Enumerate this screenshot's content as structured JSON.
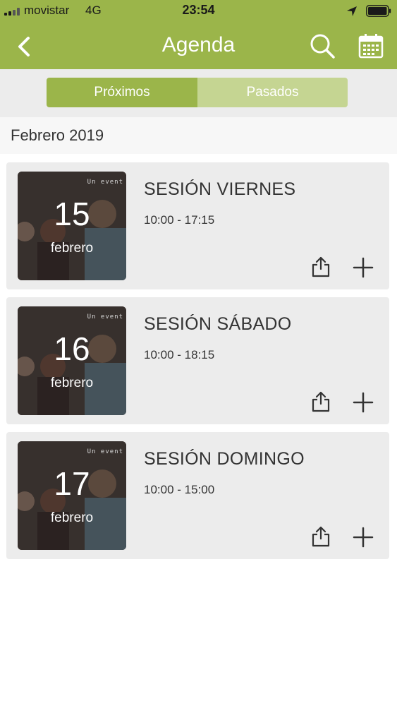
{
  "status_bar": {
    "carrier": "movistar",
    "network": "4G",
    "time": "23:54"
  },
  "nav": {
    "title": "Agenda",
    "back_icon": "chevron-left-icon",
    "search_icon": "search-icon",
    "calendar_icon": "calendar-icon"
  },
  "tabs": [
    {
      "label": "Próximos",
      "active": true
    },
    {
      "label": "Pasados",
      "active": false
    }
  ],
  "section": {
    "header": "Febrero 2019"
  },
  "events": [
    {
      "day": "15",
      "month": "febrero",
      "title": "SESIÓN VIERNES",
      "time": "10:00 - 17:15"
    },
    {
      "day": "16",
      "month": "febrero",
      "title": "SESIÓN SÁBADO",
      "time": "10:00 - 18:15"
    },
    {
      "day": "17",
      "month": "febrero",
      "title": "SESIÓN DOMINGO",
      "time": "10:00 - 15:00"
    }
  ],
  "colors": {
    "accent": "#9bb54a",
    "accent_light": "#c5d592",
    "card_bg": "#ececec",
    "text": "#333333"
  }
}
